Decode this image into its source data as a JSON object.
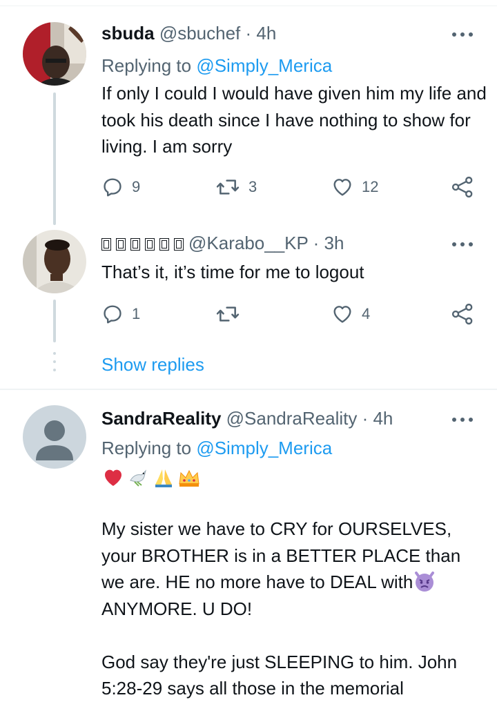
{
  "tweets": [
    {
      "name": "sbuda",
      "handle": "@sbuchef",
      "sep": " · ",
      "time": "4h",
      "replying_label": "Replying to ",
      "replying_to": "@Simply_Merica",
      "text": "If only I could I would have given him my life and took his death since I have nothing to show for living. I am sorry",
      "replies": "9",
      "retweets": "3",
      "likes": "12"
    },
    {
      "name": "",
      "handle": "@Karabo__KP",
      "sep": " · ",
      "time": "3h",
      "text": "That’s it, it’s time for me to logout",
      "replies": "1",
      "retweets": "",
      "likes": "4",
      "show_replies": "Show replies"
    },
    {
      "name": "SandraReality",
      "handle": "@SandraReality",
      "sep": " · ",
      "time": "4h",
      "replying_label": "Replying to ",
      "replying_to": "@Simply_Merica",
      "emojis": [
        "red-heart",
        "dove",
        "folded-hands",
        "crown"
      ],
      "text_p1": "My sister we have to CRY for OURSELVES, your BROTHER is in a BETTER PLACE than we are. HE no more have to DEAL with",
      "text_p1_emoji": "angry-devil",
      "text_p1_end": "ANYMORE. U DO!",
      "text_p2": "God say they're just SLEEPING to him. John 5:28-29 says all those in the memorial"
    }
  ],
  "colors": {
    "link": "#1d9bf0",
    "muted": "#536471",
    "text": "#0f1419",
    "thread_line": "#cfd9de"
  }
}
